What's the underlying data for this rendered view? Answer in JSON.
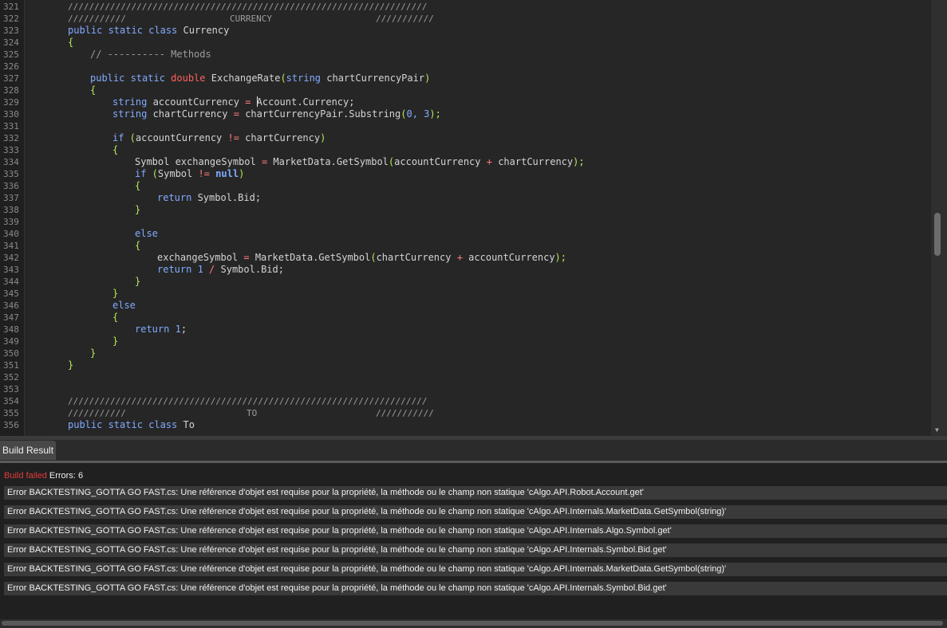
{
  "editor": {
    "line_numbers": [
      "321",
      "322",
      "323",
      "324",
      "325",
      "326",
      "327",
      "328",
      "329",
      "330",
      "331",
      "332",
      "333",
      "334",
      "335",
      "336",
      "337",
      "338",
      "339",
      "340",
      "341",
      "342",
      "343",
      "344",
      "345",
      "346",
      "347",
      "348",
      "349",
      "350",
      "351",
      "352",
      "353",
      "354",
      "355",
      "356"
    ],
    "code": {
      "l321": "////////////////////////////////////////////////////////////////////",
      "l322a": "///////////",
      "l322b": "CURRENCY",
      "l322c": "///////////",
      "l323_kw": "public static class",
      "l323_name": " Currency",
      "l324": "{",
      "l325": "// ---------- Methods",
      "l327_kw": "public static",
      "l327_type": "double",
      "l327_name": " ExchangeRate",
      "l327_p1": "(",
      "l327_kw2": "string",
      "l327_arg": " chartCurrencyPair",
      "l327_p2": ")",
      "l328": "{",
      "l329_kw": "string",
      "l329_a": " accountCurrency ",
      "l329_eq": "=",
      "l329_b": " ",
      "l329_c": "Account.Currency;",
      "l330_kw": "string",
      "l330_a": " chartCurrency ",
      "l330_eq": "=",
      "l330_b": " chartCurrencyPair.Substring",
      "l330_p": "(",
      "l330_n": "0, 3",
      "l330_e": ");",
      "l332_kw": "if",
      "l332_a": " (",
      "l332_b": "accountCurrency ",
      "l332_op": "!=",
      "l332_c": " chartCurrency",
      "l332_e": ")",
      "l333": "{",
      "l334_a": "Symbol exchangeSymbol ",
      "l334_eq": "=",
      "l334_b": " MarketData.GetSymbol",
      "l334_p": "(",
      "l334_c": "accountCurrency ",
      "l334_op": "+",
      "l334_d": " chartCurrency",
      "l334_e": ");",
      "l335_kw": "if",
      "l335_a": " (",
      "l335_b": "Symbol ",
      "l335_op": "!=",
      "l335_null": " null",
      "l335_e": ")",
      "l336": "{",
      "l337_kw": "return",
      "l337_a": " Symbol.Bid;",
      "l338": "}",
      "l340_kw": "else",
      "l341": "{",
      "l342_a": "exchangeSymbol ",
      "l342_eq": "=",
      "l342_b": " MarketData.GetSymbol",
      "l342_p": "(",
      "l342_c": "chartCurrency ",
      "l342_op": "+",
      "l342_d": " accountCurrency",
      "l342_e": ");",
      "l343_kw": "return",
      "l343_n": " 1",
      "l343_op": " /",
      "l343_a": " Symbol.Bid;",
      "l344": "}",
      "l345": "}",
      "l346_kw": "else",
      "l347": "{",
      "l348_kw": "return",
      "l348_n": " 1",
      "l348_e": ";",
      "l349": "}",
      "l350": "}",
      "l351": "}",
      "l354": "////////////////////////////////////////////////////////////////////",
      "l355a": "///////////",
      "l355b": "TO",
      "l355c": "///////////",
      "l356_kw": "public static class",
      "l356_name": " To"
    }
  },
  "build": {
    "tab_label": "Build Result",
    "status_failed": "Build failed",
    "status_errors": "Errors: 6",
    "errors": [
      "Error BACKTESTING_GOTTA GO FAST.cs: Une référence d'objet est requise pour la propriété, la méthode ou le champ non statique 'cAlgo.API.Robot.Account.get'",
      "Error BACKTESTING_GOTTA GO FAST.cs: Une référence d'objet est requise pour la propriété, la méthode ou le champ non statique 'cAlgo.API.Internals.MarketData.GetSymbol(string)'",
      "Error BACKTESTING_GOTTA GO FAST.cs: Une référence d'objet est requise pour la propriété, la méthode ou le champ non statique 'cAlgo.API.Internals.Algo.Symbol.get'",
      "Error BACKTESTING_GOTTA GO FAST.cs: Une référence d'objet est requise pour la propriété, la méthode ou le champ non statique 'cAlgo.API.Internals.Symbol.Bid.get'",
      "Error BACKTESTING_GOTTA GO FAST.cs: Une référence d'objet est requise pour la propriété, la méthode ou le champ non statique 'cAlgo.API.Internals.MarketData.GetSymbol(string)'",
      "Error BACKTESTING_GOTTA GO FAST.cs: Une référence d'objet est requise pour la propriété, la méthode ou le champ non statique 'cAlgo.API.Internals.Symbol.Bid.get'"
    ]
  },
  "colors": {
    "keyword": "#82aaff",
    "type_keyword": "#ff5f5f",
    "punctuation": "#b5e85a",
    "comment": "#9d9d9d",
    "error_status": "#e53b3b"
  },
  "icons": {
    "scroll_down": "chevron-down-icon"
  }
}
